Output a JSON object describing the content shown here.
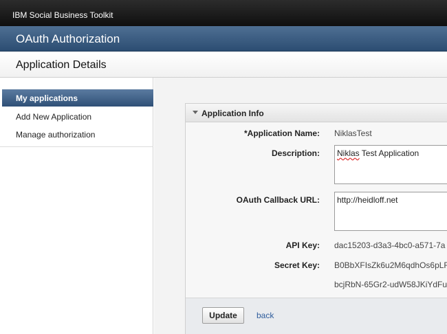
{
  "header": {
    "toolkit": "IBM Social Business Toolkit",
    "title": "OAuth Authorization",
    "subtitle": "Application Details"
  },
  "sidebar": {
    "items": [
      {
        "label": "My applications",
        "selected": true
      },
      {
        "label": "Add New Application"
      },
      {
        "label": "Manage authorization"
      }
    ]
  },
  "panel": {
    "title": "Application Info",
    "fields": {
      "app_name_label": "*Application Name:",
      "app_name_value": "NiklasTest",
      "description_label": "Description:",
      "description_value_1": "Niklas",
      "description_value_2": " Test Application",
      "callback_label": "OAuth Callback URL:",
      "callback_value": "http://heidloff.net",
      "api_key_label": "API Key:",
      "api_key_value": "dac15203-d3a3-4bc0-a571-7a",
      "secret_key_label": "Secret Key:",
      "secret_key_value_1": "B0BbXFIsZk6u2M6qdhOs6pLF",
      "secret_key_value_2": "bcjRbN-65Gr2-udW58JKiYdFu"
    },
    "actions": {
      "update": "Update",
      "back": "back"
    }
  },
  "colors": {
    "title_bar": "#3a5b80",
    "selected_nav": "#3f618a",
    "link": "#2e5c9c"
  }
}
